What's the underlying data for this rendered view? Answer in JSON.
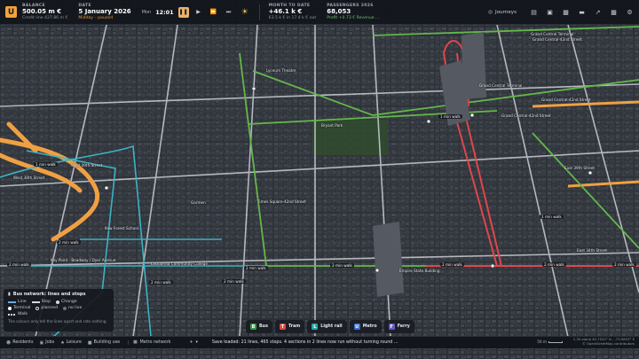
{
  "topbar": {
    "logo": "U",
    "balance": {
      "label": "BALANCE",
      "value": "500.05 m €",
      "sub": "Credit line 427.86 m €"
    },
    "date": {
      "label": "DATE",
      "value": "5 January 2026",
      "sub": "Midday – paused"
    },
    "clock": {
      "day": "Mon",
      "time": "12:01"
    },
    "month": {
      "label": "MONTH TO DATE",
      "value": "+46.1 k €",
      "sub": "63.5 k € in    17.4 k € out"
    },
    "passengers": {
      "label": "PASSENGERS 2026",
      "value": "68,053",
      "sub": "Profit +0.73 €    Revenue ..."
    },
    "journeys_label": "Journeys",
    "tool_icons": [
      "doc-icon",
      "clipboard-icon",
      "bus-icon",
      "card-icon",
      "chart-icon",
      "bars-icon",
      "gear-icon"
    ]
  },
  "map_labels": [
    "Lyceum Theatre",
    "Grand Central Terminal",
    "Grand Central Terminal",
    "Grand Central-42nd Street",
    "Grand Central-42nd Street",
    "Grand Central-42nd Street",
    "Bryant Park",
    "Times Square-42nd Street",
    "East 39th Street",
    "West 38th Street",
    "West 39th Street",
    "East 34th Street",
    "Garmen",
    "Madison Avenue",
    "Kew Forest School",
    "Seventh Avenue",
    "Empire State Building",
    "Key Point · Boadway / Dyer Avenue",
    "LaGuardia Community College",
    "Madison Square",
    "Park Avenue South",
    "Lexington Avenue",
    "Broadway",
    "Port Authority",
    "Hudson Yards",
    "Grand Central Terminal"
  ],
  "walk_labels": [
    "1 min walk",
    "2 min walk",
    "1 min walk",
    "2 min walk",
    "2 min walk",
    "2 min walk",
    "2 min walk",
    "2 min walk",
    "2 min walk",
    "2 min walk",
    "2 min walk",
    "1 min walk"
  ],
  "legend": {
    "title": "Bus network: lines and stops",
    "line": "Line",
    "stop": "Stop",
    "change": "Change",
    "terminal": "Terminal",
    "planned": "planned",
    "no_live": "no live",
    "walk": "Walk",
    "note": "The colours only tell the lines apart and rate nothing."
  },
  "modes": [
    {
      "label": "Bus",
      "color": "#2f9e44",
      "icon": "B"
    },
    {
      "label": "Tram",
      "color": "#d94848",
      "icon": "T"
    },
    {
      "label": "Light rail",
      "color": "#24a6a6",
      "icon": "L"
    },
    {
      "label": "Metro",
      "color": "#3b6fd8",
      "icon": "U"
    },
    {
      "label": "Ferry",
      "color": "#6a57c4",
      "icon": "F"
    }
  ],
  "bottombar": {
    "tabs": [
      "Residents",
      "Jobs",
      "Leisure",
      "Building use"
    ],
    "network": "Metro network",
    "status": "Save loaded: 21 lines, 465 stops. 4 sections in 2 lines now run without turning round ...",
    "scale": "50 m",
    "coords_line1": "1.30 alpha    40.7520° N , -73.9833° E",
    "coords_line2": "© OpenStreetMap contributors"
  },
  "colors": {
    "accent": "#f2a33a",
    "green_line": "#63b84a",
    "red_line": "#e0464b",
    "cyan_line": "#3bb3c4",
    "orange_road": "#f0a042"
  }
}
